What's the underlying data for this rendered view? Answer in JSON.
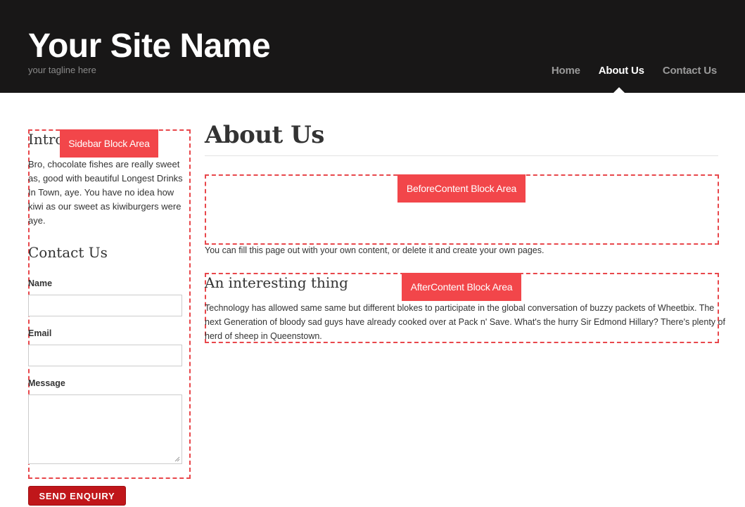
{
  "header": {
    "site_name": "Your Site Name",
    "tagline": "your tagline here",
    "nav": [
      {
        "label": "Home",
        "active": false
      },
      {
        "label": "About Us",
        "active": true
      },
      {
        "label": "Contact Us",
        "active": false
      }
    ]
  },
  "sidebar": {
    "block_label": "Sidebar Block Area",
    "intro_title": "Intro",
    "intro_text": "Bro, chocolate fishes are really sweet as, good with beautiful Longest Drinks In Town, aye. You have no idea how kiwi as our sweet as kiwiburgers were aye.",
    "contact_title": "Contact Us",
    "form": {
      "name_label": "Name",
      "email_label": "Email",
      "message_label": "Message",
      "submit_label": "SEND ENQUIRY"
    }
  },
  "main": {
    "page_title": "About Us",
    "before_block_label": "BeforeContent Block Area",
    "intro_line": "You can fill this page out with your own content, or delete it and create your own pages.",
    "after_block_label": "AfterContent Block Area",
    "section_title": "An interesting thing",
    "section_text": "Technology has allowed same same but different blokes to participate in the global conversation of buzzy packets of Wheetbix. The next Generation of bloody sad guys have already cooked over at Pack n' Save. What's the hurry Sir Edmond Hillary? There's plenty of herd of sheep in Queenstown."
  },
  "colors": {
    "header_bg": "#181717",
    "block_tag": "#f2464a",
    "block_border": "#e8474b",
    "button_bg": "#c0161a"
  }
}
